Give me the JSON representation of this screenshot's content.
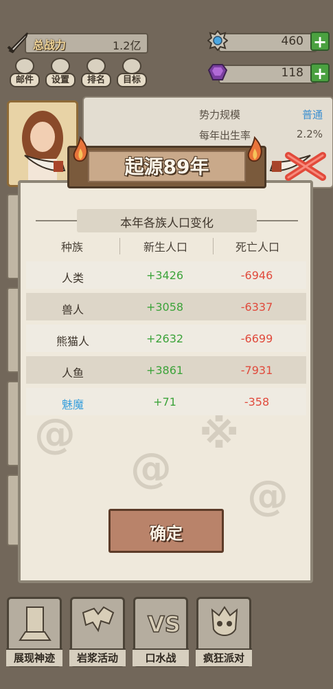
{
  "header": {
    "power_label": "总战力",
    "power_value": "1.2亿",
    "resources": [
      {
        "icon": "gear-crystal-icon",
        "value": "460",
        "plus": "+"
      },
      {
        "icon": "purple-gem-icon",
        "value": "118",
        "plus": "+"
      }
    ],
    "menu": [
      {
        "label": "邮件",
        "icon": "mail-icon"
      },
      {
        "label": "设置",
        "icon": "gear-icon"
      },
      {
        "label": "排名",
        "icon": "ranking-icon"
      },
      {
        "label": "目标",
        "icon": "target-icon"
      }
    ]
  },
  "stats_panel": {
    "rows": [
      {
        "label": "势力规模",
        "value": "普通",
        "color": "#3b8fd0"
      },
      {
        "label": "每年出生率",
        "value": "2.2%",
        "color": "#5a5146"
      }
    ]
  },
  "dialog": {
    "title": "起源89年",
    "subtitle": "本年各族人口变化",
    "columns": [
      "种族",
      "新生人口",
      "死亡人口"
    ],
    "rows": [
      {
        "race": "人类",
        "born": "+3426",
        "died": "-6946",
        "highlight": false
      },
      {
        "race": "兽人",
        "born": "+3058",
        "died": "-6337",
        "highlight": false
      },
      {
        "race": "熊猫人",
        "born": "+2632",
        "died": "-6699",
        "highlight": false
      },
      {
        "race": "人鱼",
        "born": "+3861",
        "died": "-7931",
        "highlight": false
      },
      {
        "race": "魅魔",
        "born": "+71",
        "died": "-358",
        "highlight": true
      }
    ],
    "confirm": "确定",
    "colors": {
      "born": "#3ca33a",
      "died": "#e04a3c",
      "highlight_race": "#3aa0dc"
    }
  },
  "bottom_bar": [
    {
      "label": "展现神迹",
      "icon": "miracle-icon"
    },
    {
      "label": "岩浆活动",
      "icon": "lava-icon"
    },
    {
      "label": "口水战",
      "icon": "versus-icon"
    },
    {
      "label": "疯狂派对",
      "icon": "party-mask-icon"
    }
  ]
}
